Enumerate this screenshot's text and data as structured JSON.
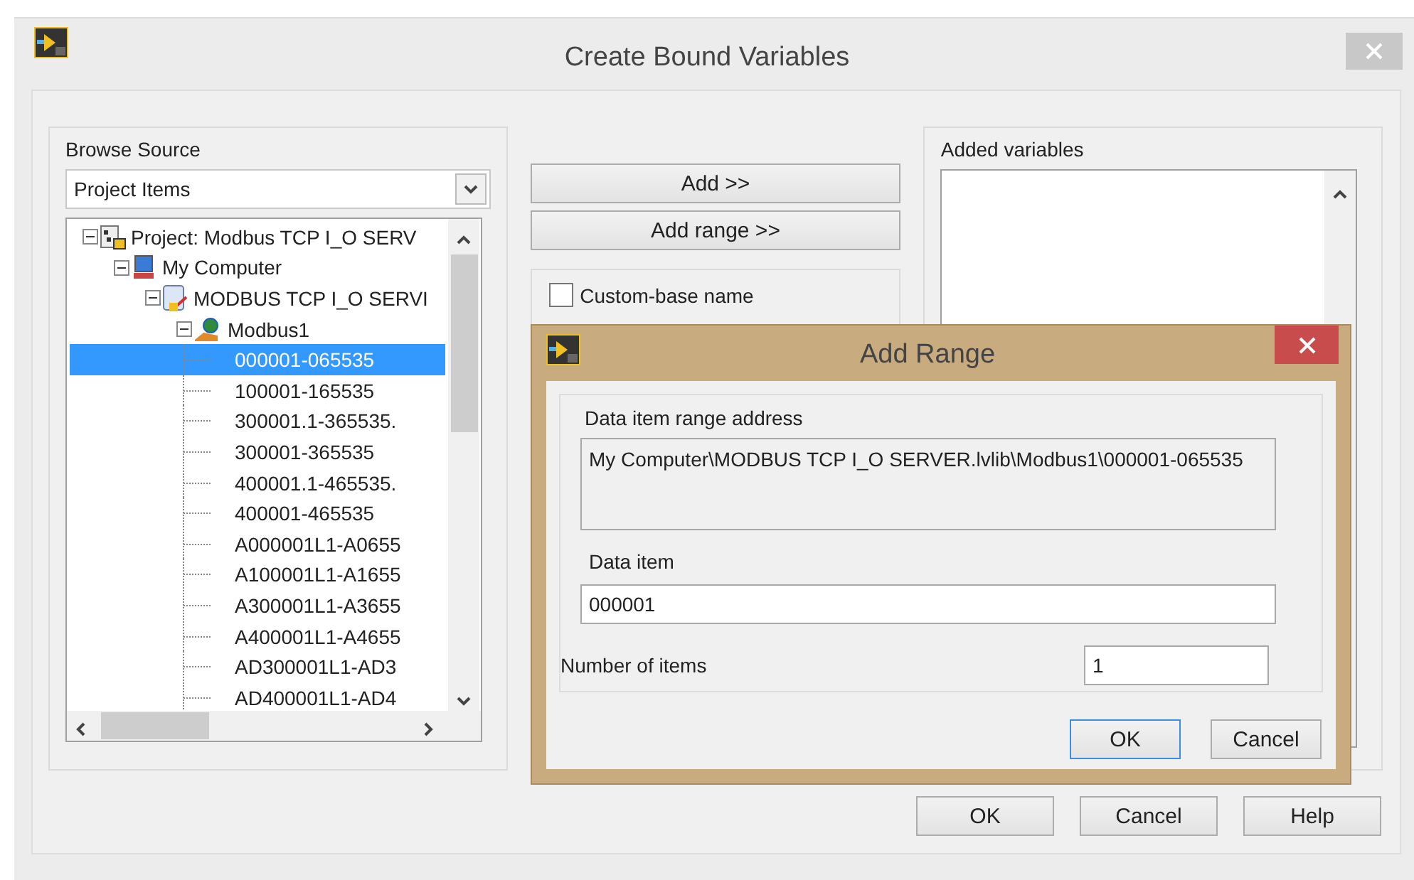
{
  "window": {
    "title": "Create Bound Variables"
  },
  "browse_source": {
    "label": "Browse Source",
    "dropdown": {
      "value": "Project Items"
    },
    "tree": [
      {
        "label": "Project: Modbus TCP I_O SERV",
        "kind": "project",
        "expanded": true,
        "selected": false,
        "children": [
          {
            "label": "My Computer",
            "kind": "computer",
            "expanded": true,
            "selected": false,
            "children": [
              {
                "label": "MODBUS TCP I_O SERVI",
                "kind": "library",
                "expanded": true,
                "selected": false,
                "children": [
                  {
                    "label": "Modbus1",
                    "kind": "server",
                    "expanded": true,
                    "selected": false,
                    "children": [
                      {
                        "label": "000001-065535",
                        "kind": "item",
                        "selected": true
                      },
                      {
                        "label": "100001-165535",
                        "kind": "item",
                        "selected": false
                      },
                      {
                        "label": "300001.1-365535.",
                        "kind": "item",
                        "selected": false
                      },
                      {
                        "label": "300001-365535",
                        "kind": "item",
                        "selected": false
                      },
                      {
                        "label": "400001.1-465535.",
                        "kind": "item",
                        "selected": false
                      },
                      {
                        "label": "400001-465535",
                        "kind": "item",
                        "selected": false
                      },
                      {
                        "label": "A000001L1-A0655",
                        "kind": "item",
                        "selected": false
                      },
                      {
                        "label": "A100001L1-A1655",
                        "kind": "item",
                        "selected": false
                      },
                      {
                        "label": "A300001L1-A3655",
                        "kind": "item",
                        "selected": false
                      },
                      {
                        "label": "A400001L1-A4655",
                        "kind": "item",
                        "selected": false
                      },
                      {
                        "label": "AD300001L1-AD3",
                        "kind": "item",
                        "selected": false
                      },
                      {
                        "label": "AD400001L1-AD4",
                        "kind": "item",
                        "selected": false
                      }
                    ]
                  }
                ]
              }
            ]
          }
        ]
      }
    ]
  },
  "middle": {
    "buttons": [
      "Add >>",
      "Add range >>"
    ],
    "custom_base_name": {
      "label": "Custom-base name",
      "checked": false
    }
  },
  "added_variables": {
    "label": "Added variables"
  },
  "buttons": [
    "OK",
    "Cancel",
    "Help"
  ],
  "add_range_dialog": {
    "title": "Add Range",
    "range_address_label": "Data  item range address",
    "range_address": "My Computer\\MODBUS TCP I_O SERVER.lvlib\\Modbus1\\000001-065535",
    "data_item_label": "Data item",
    "data_item": "000001",
    "number_of_items_label": "Number of items",
    "number_of_items": "1",
    "buttons": [
      {
        "label": "OK",
        "selected": true
      },
      {
        "label": "Cancel",
        "selected": false
      }
    ]
  }
}
